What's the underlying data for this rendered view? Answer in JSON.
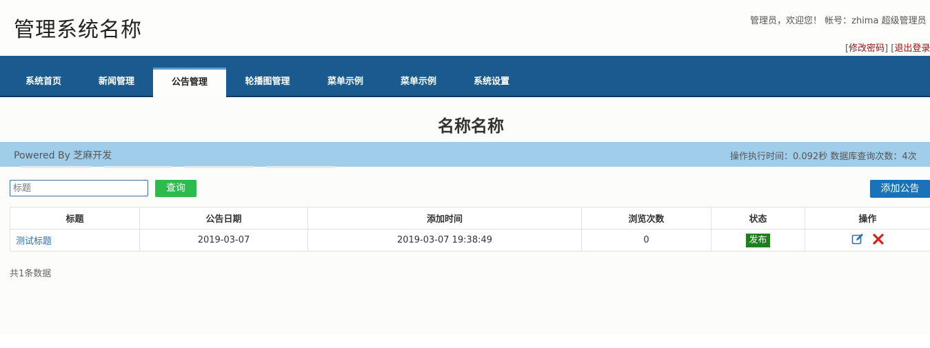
{
  "header": {
    "app_title": "管理系统名称",
    "user_line": "管理员，欢迎您！ 帐号：zhima 超级管理员",
    "change_password": "修改密码",
    "logout": "退出登录"
  },
  "nav": {
    "items": [
      {
        "label": "系统首页"
      },
      {
        "label": "新闻管理"
      },
      {
        "label": "公告管理"
      },
      {
        "label": "轮播图管理"
      },
      {
        "label": "菜单示例"
      },
      {
        "label": "菜单示例"
      },
      {
        "label": "系统设置"
      }
    ]
  },
  "page": {
    "heading": "名称名称",
    "powered": "Powered By 芝麻开发",
    "stats": "操作执行时间：0.092秒 数据库查询次数：4次"
  },
  "search": {
    "placeholder": "标题",
    "button": "查询"
  },
  "add_button": "添加公告",
  "table": {
    "headers": [
      "标题",
      "公告日期",
      "添加时间",
      "浏览次数",
      "状态",
      "操作"
    ],
    "rows": [
      {
        "title": "测试标题",
        "date": "2019-03-07",
        "added": "2019-03-07 19:38:49",
        "views": "0",
        "status": "发布"
      }
    ]
  },
  "total": "共1条数据",
  "colors": {
    "nav_bg": "#1a5a8e",
    "info_bar": "#a0cde9",
    "search_btn": "#2dbb4e",
    "add_btn": "#1a72b8",
    "badge": "#1f7f1f",
    "delete": "#e21b1b",
    "edit": "#2a6fb5"
  },
  "icons": {
    "edit": "edit-icon",
    "delete": "delete-icon"
  }
}
